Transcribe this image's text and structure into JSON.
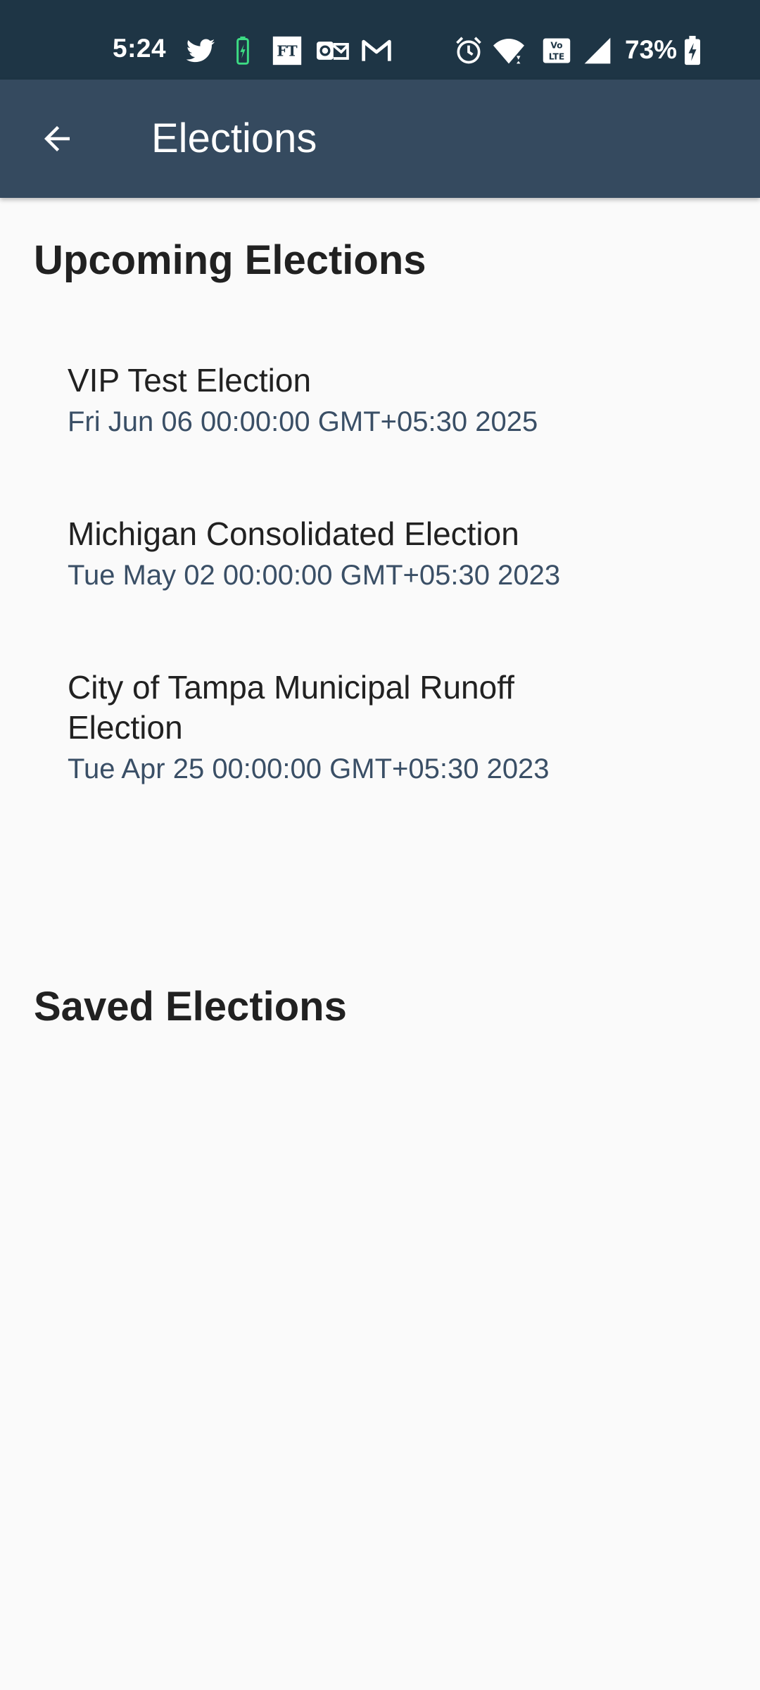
{
  "status_bar": {
    "time": "5:24",
    "battery_percent": "73%",
    "icons_left": [
      "twitter-icon",
      "battery-saver-icon",
      "ft-icon",
      "outlook-icon",
      "gmail-icon"
    ],
    "icons_right": [
      "alarm-icon",
      "wifi-icon",
      "volte-icon",
      "signal-icon",
      "battery-charging-icon"
    ]
  },
  "app_bar": {
    "back_icon": "arrow-left-icon",
    "title": "Elections"
  },
  "upcoming": {
    "title": "Upcoming Elections",
    "items": [
      {
        "name": "VIP Test Election",
        "date": "Fri Jun 06 00:00:00 GMT+05:30 2025"
      },
      {
        "name": "Michigan Consolidated Election",
        "date": "Tue May 02 00:00:00 GMT+05:30 2023"
      },
      {
        "name": "City of Tampa Municipal Runoff Election",
        "date": "Tue Apr 25 00:00:00 GMT+05:30 2023"
      }
    ]
  },
  "saved": {
    "title": "Saved Elections"
  },
  "colors": {
    "status_bar": "#1e3545",
    "app_bar": "#354a5f",
    "background": "#fafafa",
    "date_text": "#3a4f66",
    "battery_saver": "#3ddc84"
  }
}
